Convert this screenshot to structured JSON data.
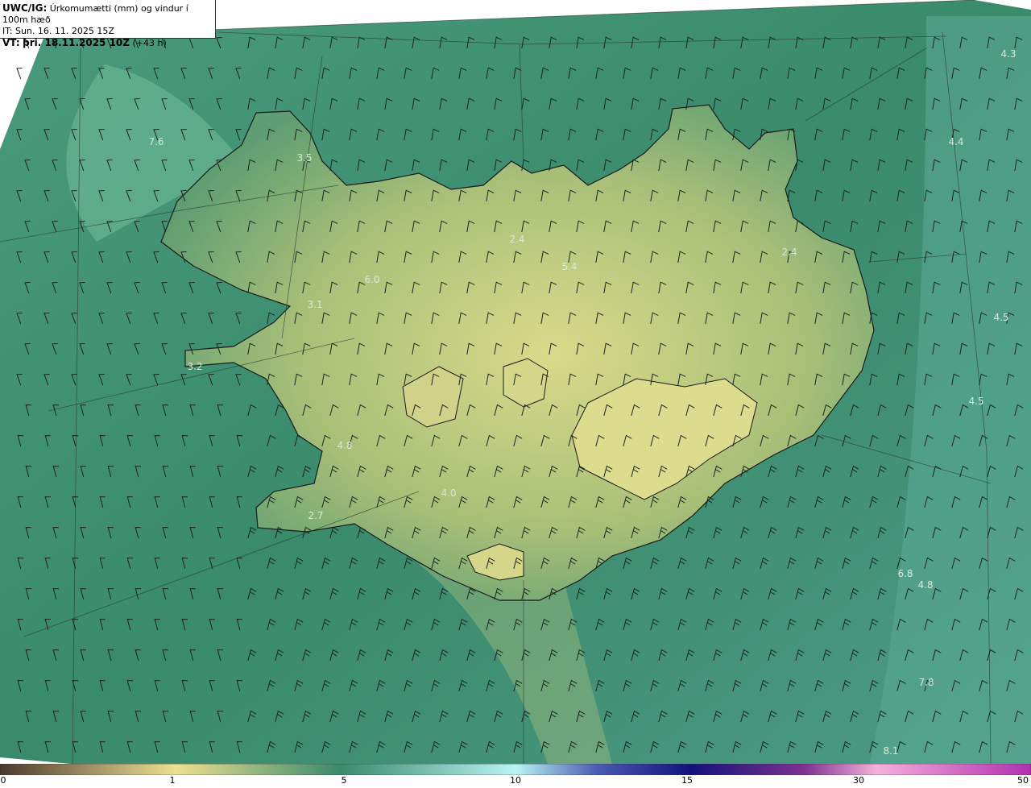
{
  "header": {
    "model": "UWC/IG:",
    "title": "Úrkomumætti (mm) og vindur í 100m hæð",
    "issue_time": "IT: Sun. 16. 11. 2025 15Z",
    "valid_label": "VT:",
    "valid_time": "þri. 18.11.2025 10Z",
    "lead": "(+43 h)"
  },
  "values": [
    {
      "text": "4.3"
    },
    {
      "text": "7.6"
    },
    {
      "text": "3.5"
    },
    {
      "text": "4.4"
    },
    {
      "text": "2.4"
    },
    {
      "text": "5.4"
    },
    {
      "text": "2.4"
    },
    {
      "text": "6.0"
    },
    {
      "text": "3.1"
    },
    {
      "text": "4.5"
    },
    {
      "text": "3.2"
    },
    {
      "text": "4.5"
    },
    {
      "text": "4.8"
    },
    {
      "text": "4.0"
    },
    {
      "text": "2.7"
    },
    {
      "text": "6.8"
    },
    {
      "text": "4.8"
    },
    {
      "text": "7.8"
    },
    {
      "text": "8.1"
    }
  ],
  "colorbar": {
    "ticks": [
      "0",
      "1",
      "5",
      "10",
      "15",
      "30",
      "50"
    ],
    "colors": [
      "#5a4a3a",
      "#a08a60",
      "#e8e090",
      "#3a8a70",
      "#b0f0f0",
      "#1a1a80",
      "#902090",
      "#f0a0d0",
      "#c040c0"
    ]
  },
  "colors": {
    "ocean": "#3c8a6e",
    "land_dry": "#d8d68a",
    "coast": "#1a1a1a"
  }
}
